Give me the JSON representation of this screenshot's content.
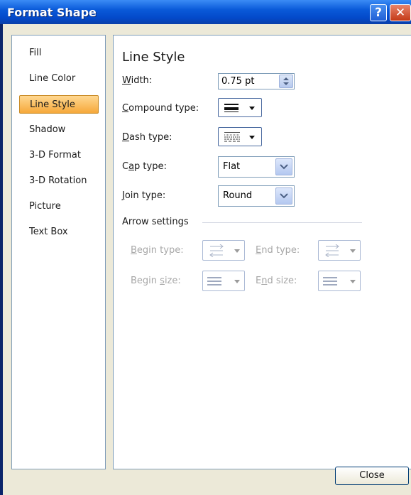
{
  "window": {
    "title": "Format Shape",
    "help_glyph": "?",
    "close_glyph": "✕"
  },
  "sidebar": {
    "items": [
      {
        "label": "Fill"
      },
      {
        "label": "Line Color"
      },
      {
        "label": "Line Style",
        "selected": true
      },
      {
        "label": "Shadow"
      },
      {
        "label": "3-D Format"
      },
      {
        "label": "3-D Rotation"
      },
      {
        "label": "Picture"
      },
      {
        "label": "Text Box"
      }
    ]
  },
  "panel": {
    "heading": "Line Style",
    "width": {
      "label_ul": "W",
      "label_rest": "idth:",
      "value": "0.75 pt"
    },
    "compound_type": {
      "label_ul": "C",
      "label_rest": "ompound type:",
      "icon": "compound-lines-icon"
    },
    "dash_type": {
      "label_ul": "D",
      "label_rest": "ash type:",
      "icon": "dash-pattern-icon"
    },
    "cap_type": {
      "label_pre": "C",
      "label_ul": "a",
      "label_rest": "p type:",
      "value": "Flat"
    },
    "join_type": {
      "label_ul": "J",
      "label_rest": "oin type:",
      "value": "Round"
    },
    "arrow_settings": {
      "group_label": "Arrow settings",
      "begin_type": {
        "label_ul": "B",
        "label_rest": "egin type:",
        "icon": "arrow-type-icon"
      },
      "end_type": {
        "label_ul": "E",
        "label_rest": "nd type:",
        "icon": "arrow-type-icon"
      },
      "begin_size": {
        "label_pre": "Begin ",
        "label_ul": "s",
        "label_rest": "ize:",
        "icon": "arrow-size-icon"
      },
      "end_size": {
        "label_pre": "E",
        "label_ul": "n",
        "label_rest": "d size:",
        "icon": "arrow-size-icon"
      }
    }
  },
  "footer": {
    "close_label": "Close"
  },
  "colors": {
    "titlebar": "#0a5ad9",
    "selected": "#f6a83a",
    "disabled_text": "#a7a7a7"
  }
}
